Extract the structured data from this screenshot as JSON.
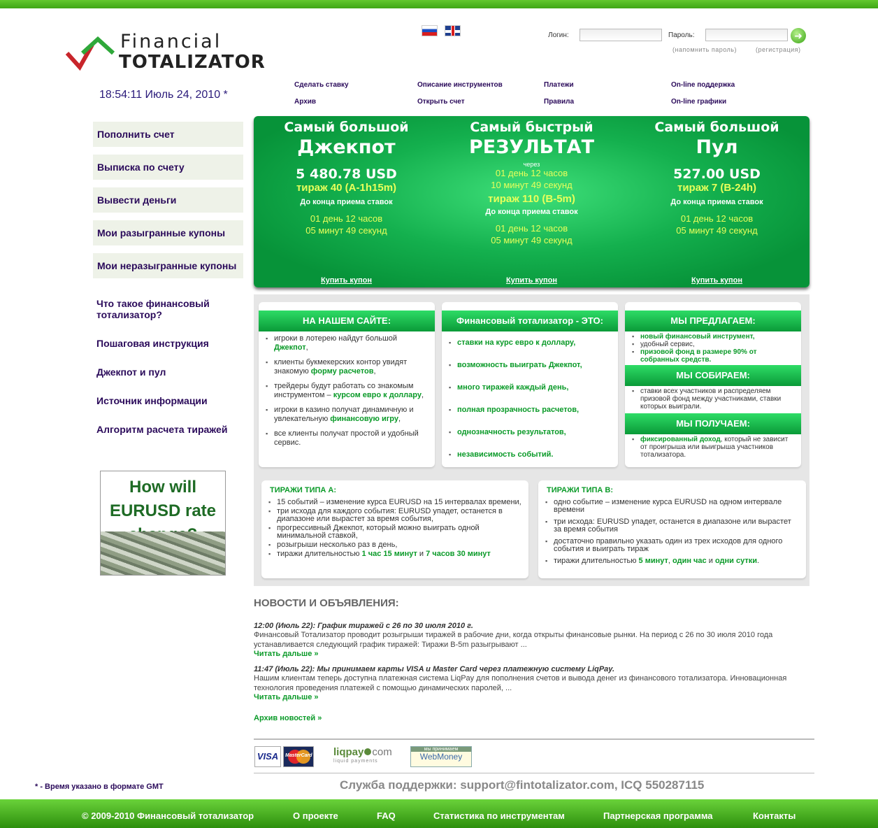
{
  "logo": {
    "line1": "Financial",
    "line2": "TOTALIZATOR"
  },
  "login": {
    "login_label": "Логин:",
    "password_label": "Пароль:",
    "go": "➜",
    "forgot": "(напомнить пароль)",
    "register": "(регистрация)"
  },
  "clock": "18:54:11 Июль 24, 2010 *",
  "nav": [
    "Сделать ставку",
    "Описание инструментов",
    "Платежи",
    "On-line поддержка",
    "Архив",
    "Открыть счет",
    "Правила",
    "On-line графики"
  ],
  "side_buttons": [
    "Пополнить счет",
    "Выписка по счету",
    "Вывести деньги",
    "Мои разыгранные купоны",
    "Мои неразыгранные купоны"
  ],
  "side_links": [
    "Что такое финансовый тотализатор?",
    "Пошаговая инструкция",
    "Джекпот и пул",
    "Источник информации",
    "Алгоритм расчета тиражей"
  ],
  "promo": "How will EURUSD rate change?",
  "banner": {
    "jackpot": {
      "h1": "Самый большой",
      "h2": "Джекпот",
      "amount": "5 480.78 USD",
      "draw": "тираж 40 (A-1h15m)",
      "until": "До конца приема ставок",
      "t1": "01 день 12 часов",
      "t2": "05 минут 49 секунд",
      "buy": "Купить купон"
    },
    "result": {
      "h1": "Самый быстрый",
      "h2": "РЕЗУЛЬТАТ",
      "via": "через",
      "t1": "01 день 12 часов",
      "t2": "10 минут 49 секунд",
      "draw": "тираж 110 (B-5m)",
      "until": "До конца приема ставок",
      "t3": "01 день 12 часов",
      "t4": "05 минут 49 секунд",
      "buy": "Купить купон"
    },
    "pool": {
      "h1": "Самый большой",
      "h2": "Пул",
      "amount": "527.00 USD",
      "draw": "тираж 7 (B-24h)",
      "until": "До конца приема ставок",
      "t1": "01 день 12 часов",
      "t2": "05 минут 49 секунд",
      "buy": "Купить купон"
    }
  },
  "box1": {
    "title": "НА НАШЕМ САЙТЕ:"
  },
  "box2": {
    "title": "Финансовый тотализатор - ЭТО:",
    "items": [
      "ставки на курс евро к доллару,",
      "возможность выиграть Джекпот,",
      "много тиражей каждый день,",
      "полная прозрачность расчетов,",
      "однозначность результатов,",
      "независимость событий."
    ]
  },
  "box3": {
    "t1": "МЫ ПРЕДЛАГАЕМ:",
    "t2": "МЫ СОБИРАЕМ:",
    "t3": "МЫ ПОЛУЧАЕМ:",
    "collect": "ставки всех участников и распределяем призовой фонд между участниками, ставки которых выиграли."
  },
  "typeA": {
    "title": "ТИРАЖИ ТИПА А:",
    "items": [
      "15 событий – изменение курса EURUSD на 15 интервалах времени,",
      "три исхода для каждого события: EURUSD упадет, останется в диапазоне или вырастет за время события,",
      "прогрессивный Джекпот, который можно выиграть одной минимальной ставкой,",
      "розыгрыши несколько раз в день,"
    ]
  },
  "typeB": {
    "title": "ТИРАЖИ ТИПА B:",
    "items": [
      "одно событие – изменение курса EURUSD на одном интервале времени",
      "три исхода: EURUSD упадет, останется в диапазоне или вырастет за время события",
      "достаточно правильно указать один из трех исходов для одного события и выиграть тираж"
    ]
  },
  "news": {
    "heading": "НОВОСТИ И ОБЪЯВЛЕНИЯ:",
    "n1_title": "12:00 (Июль 22): График тиражей с 26 по 30 июля 2010 г.",
    "n1_body": "Финансовый Тотализатор проводит розыгрыши тиражей в рабочие дни, когда открыты финансовые рынки. На период с 26 по 30 июля 2010 года устанавливается следующий график тиражей: Тиражи B-5m разыгрывают ...",
    "more": "Читать дальше »",
    "n2_title": "11:47 (Июль 22): Мы принимаем карты VISA и Master Card через платежную систему LiqPay.",
    "n2_body": "Нашим клиентам теперь доступна платежная система LiqPay для пополнения счетов и вывода денег из финансового тотализатора. Инновационная технология проведения платежей с помощью динамических паролей, ...",
    "archive": "Архив новостей »"
  },
  "pay": {
    "visa": "VISA",
    "mc": "MasterCard",
    "liqpay": "liqpay",
    "liqpay_dot": "com",
    "liqpay_sub": "liquid payments",
    "wm_top": "мы принимаем",
    "wm": "WebMoney"
  },
  "support": "Служба поддержки: support@fintotalizator.com, ICQ 550287115",
  "gmt": "* - Время указано в формате GMT",
  "footer": [
    "© 2009-2010 Финансовый тотализатор",
    "О проекте",
    "FAQ",
    "Статистика по инструментам",
    "Партнерская программа",
    "Контакты"
  ]
}
